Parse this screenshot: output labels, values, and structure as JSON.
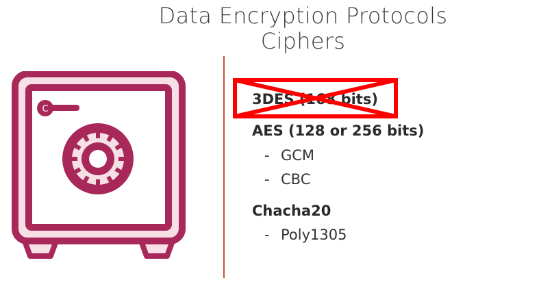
{
  "slide": {
    "title_line1": "Data Encryption Protocols",
    "title_line2": "Ciphers"
  },
  "ciphers": {
    "deprecated": {
      "label": "3DES (168 bits)",
      "struck": true
    },
    "aes": {
      "label": "AES (128 or 256 bits)",
      "modes": [
        "GCM",
        "CBC"
      ]
    },
    "chacha": {
      "label": "Chacha20",
      "modes": [
        "Poly1305"
      ]
    }
  },
  "list_marker": "-",
  "icon": {
    "name": "safe-icon",
    "color": "#a8285a",
    "fill": "#f6e0e6"
  },
  "strike_color": "#ff0000",
  "divider_color": "#c9502a"
}
